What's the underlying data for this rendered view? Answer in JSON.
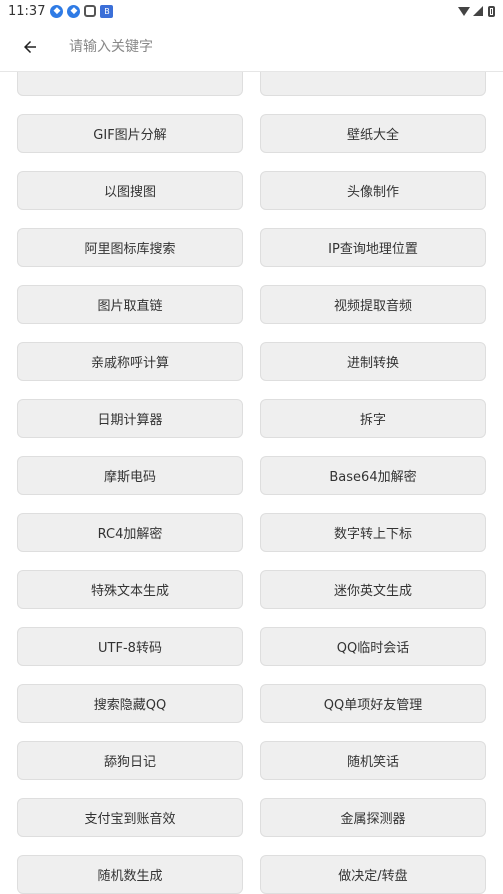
{
  "status_bar": {
    "time": "11:37"
  },
  "search": {
    "placeholder": "请输入关键字"
  },
  "tools": [
    {
      "label": ""
    },
    {
      "label": ""
    },
    {
      "label": "GIF图片分解"
    },
    {
      "label": "壁纸大全"
    },
    {
      "label": "以图搜图"
    },
    {
      "label": "头像制作"
    },
    {
      "label": "阿里图标库搜索"
    },
    {
      "label": "IP查询地理位置"
    },
    {
      "label": "图片取直链"
    },
    {
      "label": "视频提取音频"
    },
    {
      "label": "亲戚称呼计算"
    },
    {
      "label": "进制转换"
    },
    {
      "label": "日期计算器"
    },
    {
      "label": "拆字"
    },
    {
      "label": "摩斯电码"
    },
    {
      "label": "Base64加解密"
    },
    {
      "label": "RC4加解密"
    },
    {
      "label": "数字转上下标"
    },
    {
      "label": "特殊文本生成"
    },
    {
      "label": "迷你英文生成"
    },
    {
      "label": "UTF-8转码"
    },
    {
      "label": "QQ临时会话"
    },
    {
      "label": "搜索隐藏QQ"
    },
    {
      "label": "QQ单项好友管理"
    },
    {
      "label": "舔狗日记"
    },
    {
      "label": "随机笑话"
    },
    {
      "label": "支付宝到账音效"
    },
    {
      "label": "金属探测器"
    },
    {
      "label": "随机数生成"
    },
    {
      "label": "做决定/转盘"
    }
  ]
}
